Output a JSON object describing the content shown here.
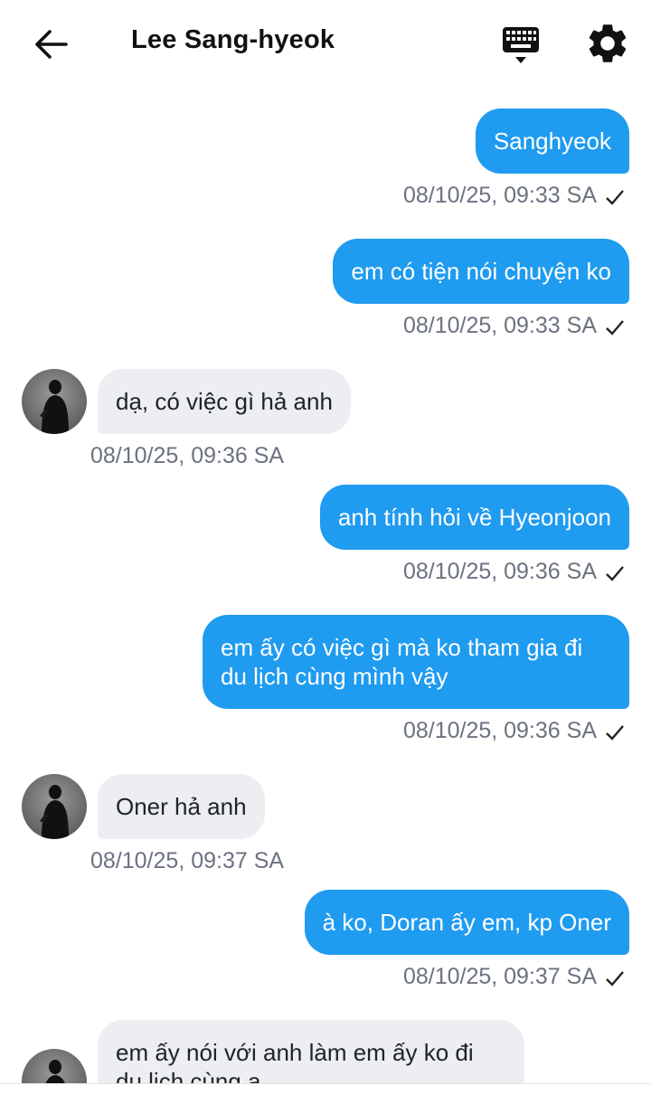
{
  "header": {
    "title": "Lee Sang-hyeok",
    "back_icon": "arrow-left-icon",
    "keyboard_icon": "keyboard-icon",
    "settings_icon": "gear-icon"
  },
  "colors": {
    "outgoing_bubble": "#1f9bf0",
    "incoming_bubble": "#eceef1",
    "timestamp": "#6b7280"
  },
  "messages": [
    {
      "dir": "out",
      "text": "Sanghyeok",
      "time": "08/10/25, 09:33 SA"
    },
    {
      "dir": "out",
      "text": "em có tiện nói chuyện ko",
      "time": "08/10/25, 09:33 SA"
    },
    {
      "dir": "in",
      "text": "dạ, có việc gì hả anh",
      "time": "08/10/25, 09:36 SA"
    },
    {
      "dir": "out",
      "text": "anh tính hỏi về Hyeonjoon",
      "time": "08/10/25, 09:36 SA"
    },
    {
      "dir": "out",
      "text_line1": "em ấy có việc gì mà ko tham gia đi",
      "text_line2": "du lịch cùng mình vậy",
      "time": "08/10/25, 09:36 SA"
    },
    {
      "dir": "in",
      "text": "Oner hả anh",
      "time": "08/10/25, 09:37 SA"
    },
    {
      "dir": "out",
      "text": "à ko, Doran ấy em, kp Oner",
      "time": "08/10/25, 09:37 SA"
    },
    {
      "dir": "in",
      "text_line1": "em ấy nói với anh làm em ấy ko đi",
      "text_line2": "du lịch cùng a..."
    }
  ]
}
